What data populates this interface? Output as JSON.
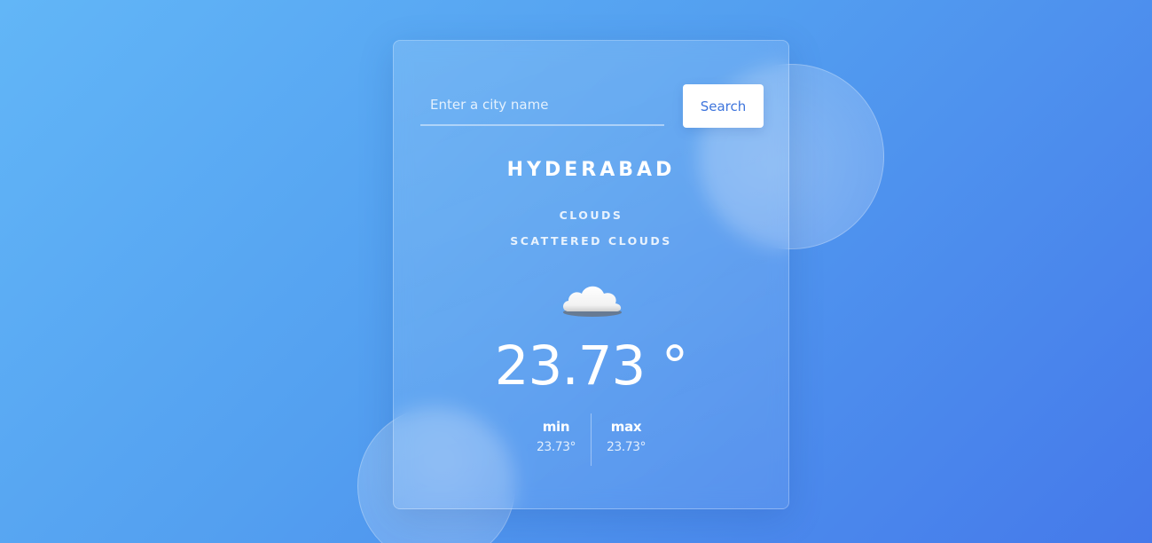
{
  "search": {
    "placeholder": "Enter a city name",
    "value": "",
    "button_label": "Search"
  },
  "weather": {
    "city": "HYDERABAD",
    "condition": "CLOUDS",
    "description": "SCATTERED CLOUDS",
    "icon": "cloud-icon",
    "temperature": "23.73 °",
    "min_label": "min",
    "min_value": "23.73°",
    "max_label": "max",
    "max_value": "23.73°"
  },
  "colors": {
    "background_start": "#62b6f7",
    "background_end": "#4579ea",
    "button_text": "#3d74dc",
    "text": "#ffffff"
  }
}
